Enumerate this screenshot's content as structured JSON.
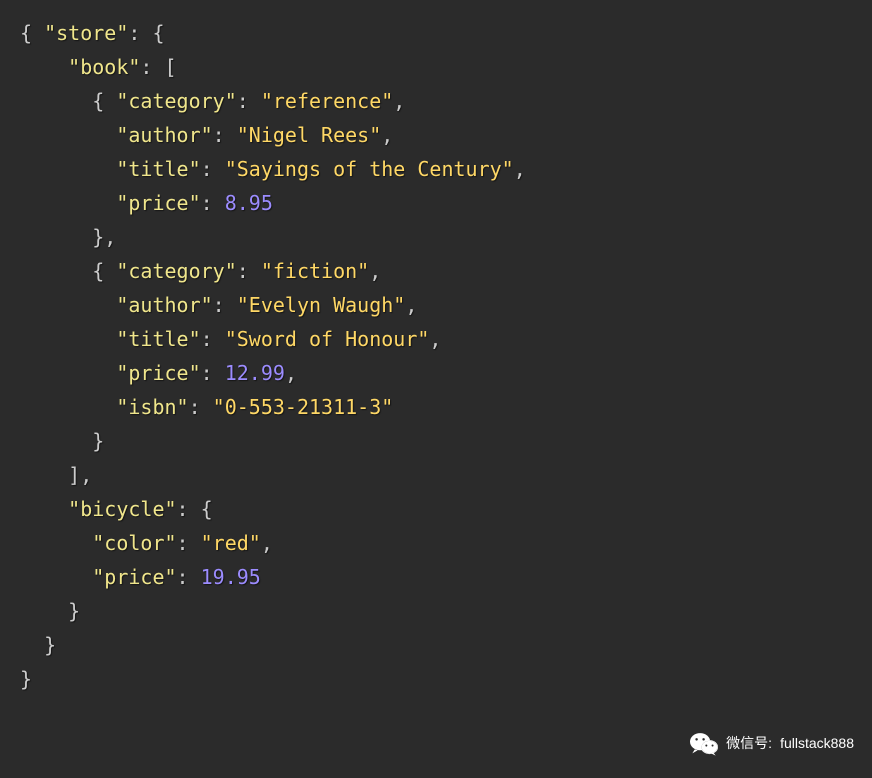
{
  "code": {
    "line1_key_store": "\"store\"",
    "line2_key_book": "\"book\"",
    "line3_key_category": "\"category\"",
    "line3_val_category": "\"reference\"",
    "line4_key_author": "\"author\"",
    "line4_val_author": "\"Nigel Rees\"",
    "line5_key_title": "\"title\"",
    "line5_val_title": "\"Sayings of the Century\"",
    "line6_key_price": "\"price\"",
    "line6_val_price": "8.95",
    "line8_key_category": "\"category\"",
    "line8_val_category": "\"fiction\"",
    "line9_key_author": "\"author\"",
    "line9_val_author": "\"Evelyn Waugh\"",
    "line10_key_title": "\"title\"",
    "line10_val_title": "\"Sword of Honour\"",
    "line11_key_price": "\"price\"",
    "line11_val_price": "12.99",
    "line12_key_isbn": "\"isbn\"",
    "line12_val_isbn": "\"0-553-21311-3\"",
    "line15_key_bicycle": "\"bicycle\"",
    "line16_key_color": "\"color\"",
    "line16_val_color": "\"red\"",
    "line17_key_price": "\"price\"",
    "line17_val_price": "19.95"
  },
  "watermark": {
    "label": "微信号:",
    "account": "fullstack888"
  }
}
